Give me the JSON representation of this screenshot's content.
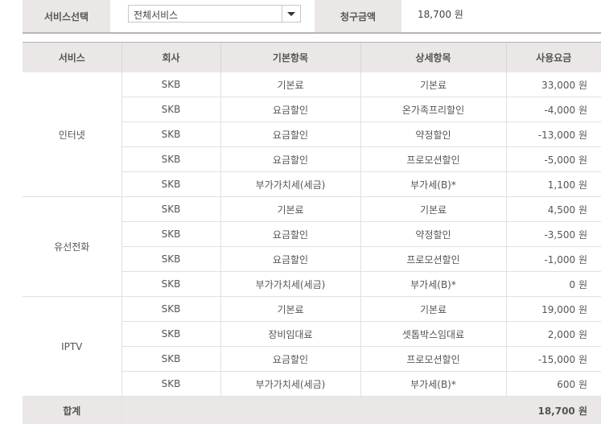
{
  "filter": {
    "service_label": "서비스선택",
    "service_selected": "전체서비스",
    "amount_label": "청구금액",
    "amount_value": "18,700 원"
  },
  "table": {
    "headers": [
      "서비스",
      "회사",
      "기본항목",
      "상세항목",
      "사용요금"
    ],
    "groups": [
      {
        "service": "인터넷",
        "rows": [
          {
            "company": "SKB",
            "basic": "기본료",
            "detail": "기본료",
            "fee": "33,000 원"
          },
          {
            "company": "SKB",
            "basic": "요금할인",
            "detail": "온가족프리할인",
            "fee": "-4,000 원"
          },
          {
            "company": "SKB",
            "basic": "요금할인",
            "detail": "약정할인",
            "fee": "-13,000 원"
          },
          {
            "company": "SKB",
            "basic": "요금할인",
            "detail": "프로모션할인",
            "fee": "-5,000 원"
          },
          {
            "company": "SKB",
            "basic": "부가가치세(세금)",
            "detail": "부가세(B)*",
            "fee": "1,100 원"
          }
        ]
      },
      {
        "service": "유선전화",
        "rows": [
          {
            "company": "SKB",
            "basic": "기본료",
            "detail": "기본료",
            "fee": "4,500 원"
          },
          {
            "company": "SKB",
            "basic": "요금할인",
            "detail": "약정할인",
            "fee": "-3,500 원"
          },
          {
            "company": "SKB",
            "basic": "요금할인",
            "detail": "프로모션할인",
            "fee": "-1,000 원"
          },
          {
            "company": "SKB",
            "basic": "부가가치세(세금)",
            "detail": "부가세(B)*",
            "fee": "0 원"
          }
        ]
      },
      {
        "service": "IPTV",
        "rows": [
          {
            "company": "SKB",
            "basic": "기본료",
            "detail": "기본료",
            "fee": "19,000 원"
          },
          {
            "company": "SKB",
            "basic": "장비임대료",
            "detail": "셋톱박스임대료",
            "fee": "2,000 원"
          },
          {
            "company": "SKB",
            "basic": "요금할인",
            "detail": "프로모션할인",
            "fee": "-15,000 원"
          },
          {
            "company": "SKB",
            "basic": "부가가치세(세금)",
            "detail": "부가세(B)*",
            "fee": "600 원"
          }
        ]
      }
    ],
    "total": {
      "label": "합계",
      "fee": "18,700 원"
    }
  },
  "colors": {
    "header_bg": "#ebe7e6",
    "total_fee": "#b4123e"
  }
}
